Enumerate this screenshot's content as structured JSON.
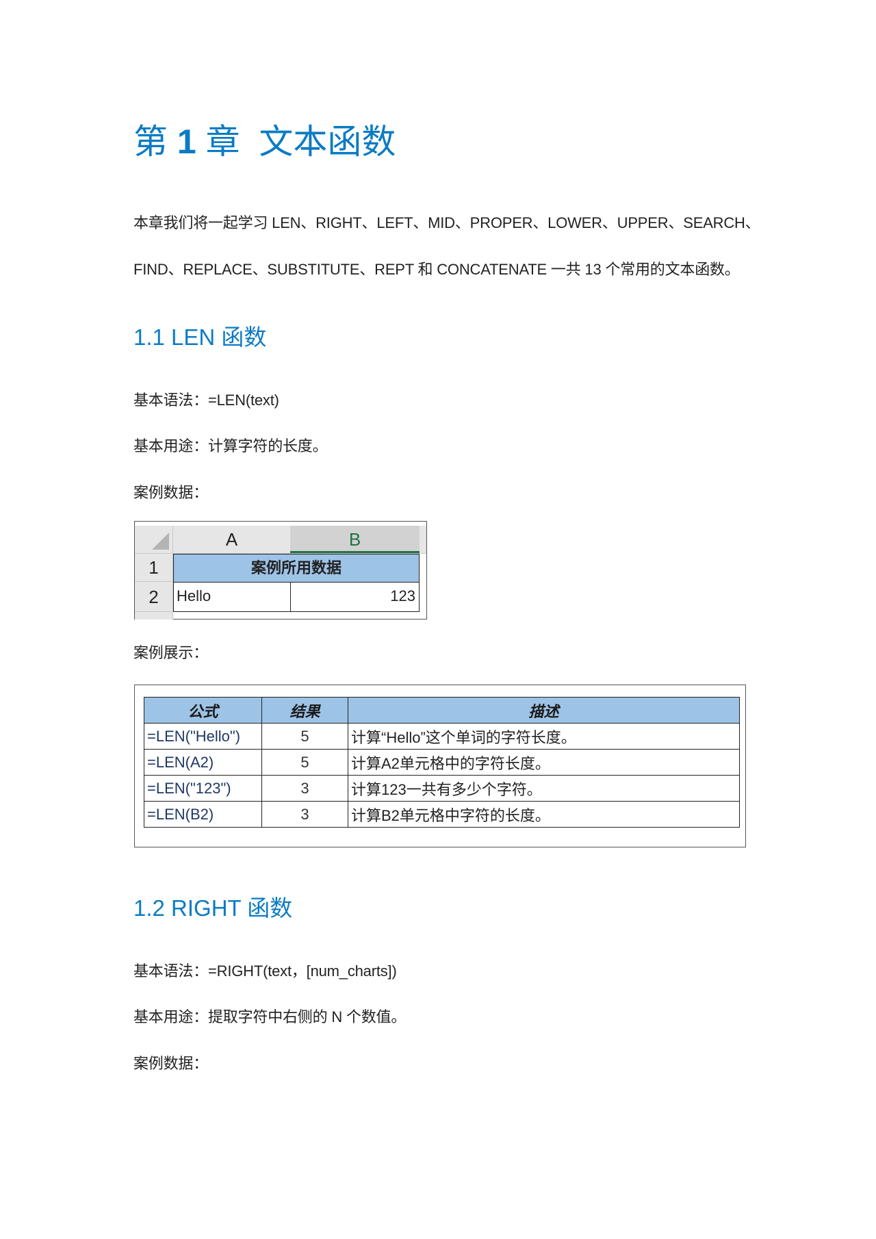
{
  "chapter": {
    "title_prefix": "第",
    "title_number": "1",
    "title_suffix": "章  文本函数"
  },
  "intro": {
    "line1": "本章我们将一起学习 LEN、RIGHT、LEFT、MID、PROPER、LOWER、UPPER、SEARCH、",
    "line2": "FIND、REPLACE、SUBSTITUTE、REPT 和 CONCATENATE 一共 13 个常用的文本函数。"
  },
  "sections": [
    {
      "heading": "1.1 LEN 函数",
      "syntax": "基本语法：=LEN(text)",
      "usage": "基本用途：计算字符的长度。",
      "data_label": "案例数据：",
      "sheet": {
        "col_headers": [
          "A",
          "B"
        ],
        "row_numbers": [
          "1",
          "2"
        ],
        "merged_header": "案例所用数据",
        "a2": "Hello",
        "b2": "123"
      },
      "demo_label": "案例展示：",
      "examples": {
        "headers": [
          "公式",
          "结果",
          "描述"
        ],
        "rows": [
          {
            "formula": "=LEN(\"Hello\")",
            "result": "5",
            "desc": "计算“Hello”这个单词的字符长度。"
          },
          {
            "formula": "=LEN(A2)",
            "result": "5",
            "desc": "计算A2单元格中的字符长度。"
          },
          {
            "formula": "=LEN(\"123\")",
            "result": "3",
            "desc": "计算123一共有多少个字符。"
          },
          {
            "formula": "=LEN(B2)",
            "result": "3",
            "desc": "计算B2单元格中字符的长度。"
          }
        ]
      }
    },
    {
      "heading": "1.2 RIGHT 函数",
      "syntax": "基本语法：=RIGHT(text，[num_charts])",
      "usage": "基本用途：提取字符中右侧的 N 个数值。",
      "data_label": "案例数据："
    }
  ],
  "colors": {
    "accent": "#0b7bc4",
    "table_header_fill": "#9dc3e6",
    "excel_selected_col": "#217346"
  }
}
